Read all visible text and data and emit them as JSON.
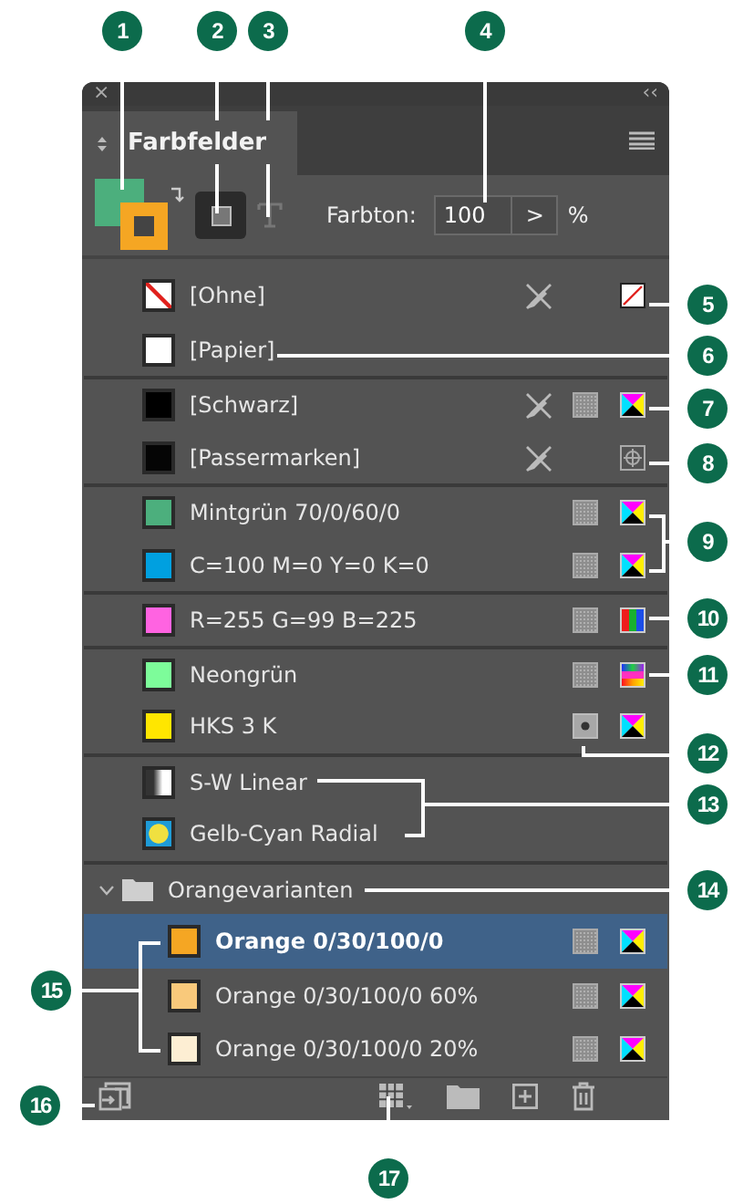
{
  "panel": {
    "close": "×",
    "collapse": "‹‹",
    "tab": "Farbfelder",
    "fill": {
      "color": "#4caf7d"
    },
    "stroke": {
      "color": "#f5a623"
    },
    "container_selected": true,
    "text_selected": false,
    "tint_label": "Farbton:",
    "tint_value": "100",
    "tint_button": ">",
    "tint_unit": "%"
  },
  "items": [
    {
      "kind": "swatch",
      "name": "[Ohne]",
      "chip": {
        "kind": "none"
      },
      "locked": true,
      "mode": {
        "kind": "none"
      },
      "separator": false,
      "selected": false
    },
    {
      "kind": "swatch",
      "name": "[Papier]",
      "chip": {
        "kind": "paper"
      },
      "locked": false,
      "separator": false,
      "selected": false
    },
    {
      "kind": "swatch",
      "name": "[Schwarz]",
      "chip": {
        "kind": "solid",
        "color": "#000000"
      },
      "locked": true,
      "tone": {
        "kind": "process"
      },
      "mode": {
        "kind": "cmyk"
      },
      "separator": true,
      "selected": false
    },
    {
      "kind": "swatch",
      "name": "[Passermarken]",
      "chip": {
        "kind": "solid",
        "color": "#050505"
      },
      "locked": true,
      "mode": {
        "kind": "registration"
      },
      "separator": false,
      "selected": false
    },
    {
      "kind": "swatch",
      "name": "Mintgrün 70/0/60/0",
      "chip": {
        "kind": "solid",
        "color": "#4caf7d"
      },
      "locked": false,
      "tone": {
        "kind": "process"
      },
      "mode": {
        "kind": "cmyk"
      },
      "separator": true,
      "selected": false
    },
    {
      "kind": "swatch",
      "name": "C=100 M=0 Y=0 K=0",
      "chip": {
        "kind": "solid",
        "color": "#00a0e0"
      },
      "locked": false,
      "tone": {
        "kind": "process"
      },
      "mode": {
        "kind": "cmyk"
      },
      "separator": false,
      "selected": false
    },
    {
      "kind": "swatch",
      "name": "R=255 G=99 B=225",
      "chip": {
        "kind": "solid",
        "color": "#ff63e1"
      },
      "locked": false,
      "tone": {
        "kind": "process"
      },
      "mode": {
        "kind": "rgb"
      },
      "separator": true,
      "selected": false
    },
    {
      "kind": "swatch",
      "name": "Neongrün",
      "chip": {
        "kind": "solid",
        "color": "#7dfc9a"
      },
      "locked": false,
      "tone": {
        "kind": "process"
      },
      "mode": {
        "kind": "lab"
      },
      "separator": true,
      "selected": false
    },
    {
      "kind": "swatch",
      "name": "HKS 3 K",
      "chip": {
        "kind": "solid",
        "color": "#ffe600"
      },
      "locked": false,
      "tone": {
        "kind": "spot"
      },
      "mode": {
        "kind": "cmyk"
      },
      "separator": false,
      "selected": false
    },
    {
      "kind": "swatch",
      "name": "S-W Linear",
      "chip": {
        "kind": "linear",
        "stops": [
          {
            "color": "#333333"
          },
          {
            "color": "#ffffff"
          }
        ]
      },
      "locked": false,
      "separator": true,
      "selected": false
    },
    {
      "kind": "swatch",
      "name": "Gelb-Cyan Radial",
      "chip": {
        "kind": "radial",
        "stops": [
          {
            "color": "#f0e040"
          },
          {
            "color": "#1e9bd7"
          }
        ]
      },
      "locked": false,
      "separator": false,
      "selected": false
    },
    {
      "kind": "group",
      "name": "Orangevarianten",
      "expanded": true,
      "separator": true,
      "children": [
        {
          "kind": "swatch",
          "name": "Orange 0/30/100/0",
          "chip": {
            "kind": "solid",
            "color": "#f5a623"
          },
          "locked": false,
          "tone": {
            "kind": "process"
          },
          "mode": {
            "kind": "cmyk"
          },
          "separator": false,
          "selected": true
        },
        {
          "kind": "swatch",
          "name": "Orange 0/30/100/0 60%",
          "chip": {
            "kind": "solid",
            "color": "#f9c97b"
          },
          "locked": false,
          "tone": {
            "kind": "process"
          },
          "mode": {
            "kind": "cmyk"
          },
          "separator": false,
          "selected": false
        },
        {
          "kind": "swatch",
          "name": "Orange 0/30/100/0 20%",
          "chip": {
            "kind": "solid",
            "color": "#fdeed3"
          },
          "locked": false,
          "tone": {
            "kind": "process"
          },
          "mode": {
            "kind": "cmyk"
          },
          "separator": false,
          "selected": false
        }
      ]
    }
  ],
  "callouts": [
    {
      "number": "1"
    },
    {
      "number": "2"
    },
    {
      "number": "3"
    },
    {
      "number": "4"
    },
    {
      "number": "5"
    },
    {
      "number": "6"
    },
    {
      "number": "7"
    },
    {
      "number": "8"
    },
    {
      "number": "9"
    },
    {
      "number": "10"
    },
    {
      "number": "11"
    },
    {
      "number": "12"
    },
    {
      "number": "13"
    },
    {
      "number": "14"
    },
    {
      "number": "15"
    },
    {
      "number": "16"
    },
    {
      "number": "17"
    }
  ]
}
